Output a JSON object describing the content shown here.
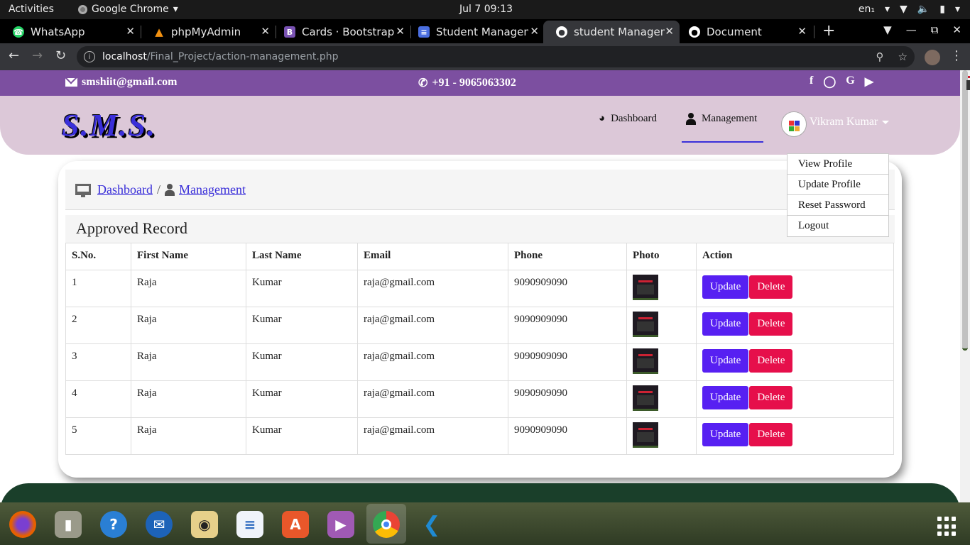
{
  "system": {
    "activities": "Activities",
    "app_name": "Google Chrome",
    "clock": "Jul 7  09:13",
    "lang": "en₁"
  },
  "tabs": [
    {
      "title": "WhatsApp",
      "icon": "whatsapp-icon",
      "color": "#25d366",
      "active": false
    },
    {
      "title": "phpMyAdmin",
      "icon": "phpmyadmin-icon",
      "color": "#f29111",
      "active": false
    },
    {
      "title": "Cards · Bootstrap",
      "icon": "bootstrap-icon",
      "color": "#7952b3",
      "active": false
    },
    {
      "title": "Student Managem",
      "icon": "docs-icon",
      "color": "#4a6ee0",
      "active": false
    },
    {
      "title": "student Managem",
      "icon": "globe-icon",
      "color": "#ffffff",
      "active": true
    },
    {
      "title": "Document",
      "icon": "globe-icon",
      "color": "#ffffff",
      "active": false
    }
  ],
  "url": {
    "host": "localhost",
    "path": "/Final_Project/action-management.php"
  },
  "site": {
    "email": "smshiit@gmail.com",
    "phone": "+91 - 9065063302",
    "social": [
      "facebook-icon",
      "instagram-icon",
      "google-icon",
      "youtube-icon"
    ],
    "logo": "S.M.S.",
    "nav": {
      "dashboard": "Dashboard",
      "management": "Management"
    },
    "user": "Vikram Kumar",
    "dropdown": [
      "View Profile",
      "Update Profile",
      "Reset Password",
      "Logout"
    ],
    "breadcrumb": {
      "home": "Dashboard",
      "sep": "/",
      "current": "Management"
    },
    "section_title": "Approved Record"
  },
  "table": {
    "headers": [
      "S.No.",
      "First Name",
      "Last Name",
      "Email",
      "Phone",
      "Photo",
      "Action"
    ],
    "rows": [
      {
        "sno": "1",
        "first": "Raja",
        "last": "Kumar",
        "email": "raja@gmail.com",
        "phone": "9090909090"
      },
      {
        "sno": "2",
        "first": "Raja",
        "last": "Kumar",
        "email": "raja@gmail.com",
        "phone": "9090909090"
      },
      {
        "sno": "3",
        "first": "Raja",
        "last": "Kumar",
        "email": "raja@gmail.com",
        "phone": "9090909090"
      },
      {
        "sno": "4",
        "first": "Raja",
        "last": "Kumar",
        "email": "raja@gmail.com",
        "phone": "9090909090"
      },
      {
        "sno": "5",
        "first": "Raja",
        "last": "Kumar",
        "email": "raja@gmail.com",
        "phone": "9090909090"
      }
    ],
    "update_label": "Update",
    "delete_label": "Delete"
  },
  "colors": {
    "brand": "#7c4fa0",
    "header": "#dcc8d8",
    "update": "#5720f2",
    "delete": "#e60f4b",
    "footer": "#1a3f2a"
  },
  "dock": [
    {
      "name": "firefox-icon",
      "color": "#e66000"
    },
    {
      "name": "files-icon",
      "color": "#9a9a8a"
    },
    {
      "name": "help-icon",
      "color": "#2a7fd4"
    },
    {
      "name": "thunderbird-icon",
      "color": "#1d63b8"
    },
    {
      "name": "rhythmbox-icon",
      "color": "#e6d08a"
    },
    {
      "name": "libreoffice-writer-icon",
      "color": "#2f6cc0"
    },
    {
      "name": "software-center-icon",
      "color": "#e8572a"
    },
    {
      "name": "videos-icon",
      "color": "#a05ab4"
    },
    {
      "name": "chrome-icon",
      "color": "#ea4335"
    },
    {
      "name": "vscode-icon",
      "color": "#1f8ad2"
    }
  ]
}
